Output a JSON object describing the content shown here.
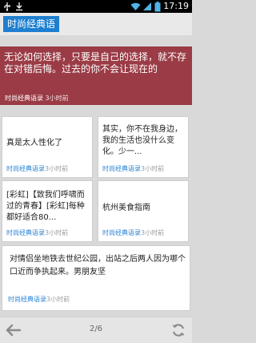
{
  "status_bar": {
    "time": "17:19",
    "icons": [
      "usb-icon",
      "download-icon",
      "wifi-icon",
      "signal-icon",
      "battery-icon"
    ]
  },
  "header": {
    "title": "时尚经典语"
  },
  "hero": {
    "text": "无论如何选择，只要是自己的选择，就不存在对错后悔。过去的你不会让现在的",
    "source": "时尚经典语录",
    "time": "3小时前"
  },
  "cards": [
    {
      "text": "真是太人性化了",
      "source": "时尚经典语录",
      "time": "3小时前"
    },
    {
      "text": "其实，你不在我身边，我的生活也没什么变化。少一...",
      "source": "时尚经典语录",
      "time": "3小时前"
    },
    {
      "text": "[彩虹]【致我们呼啸而过的青春】[彩虹]每种都好适合80...",
      "source": "时尚经典语录",
      "time": "3小时前"
    },
    {
      "text": "杭州美食指南",
      "source": "时尚经典语录",
      "time": "3小时前"
    }
  ],
  "wide_card": {
    "text": "对情侣坐地铁去世纪公园，出站之后两人因为哪个口近而争执起来。男朋友坚",
    "source": "时尚经典语录",
    "time": "3小时前"
  },
  "bottom_bar": {
    "page_indicator": "2/6",
    "back_icon": "arrow-left-icon",
    "refresh_icon": "refresh-icon"
  },
  "colors": {
    "accent": "#1e7fd0",
    "hero_bg": "#9a3b45",
    "link": "#2a83d6"
  }
}
